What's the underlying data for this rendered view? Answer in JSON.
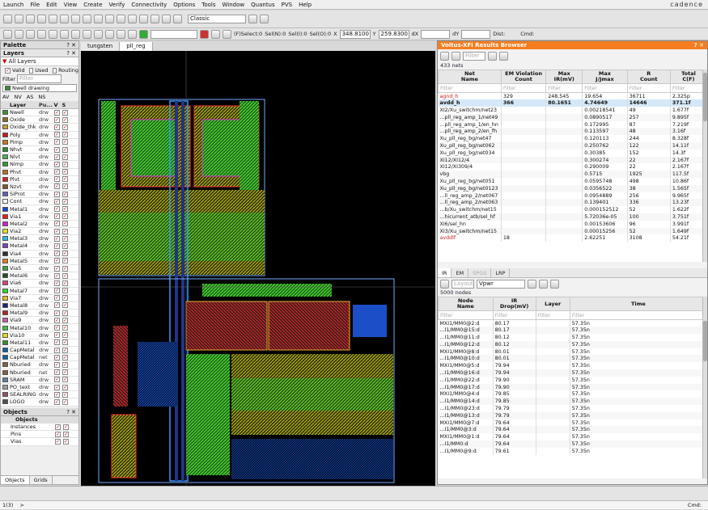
{
  "menu": [
    "Launch",
    "File",
    "Edit",
    "View",
    "Create",
    "Verify",
    "Connectivity",
    "Options",
    "Tools",
    "Window",
    "Quantus",
    "PVS",
    "Help"
  ],
  "brand": "cadence",
  "toolbar": {
    "workspace": "Classic",
    "select_status": "(F)Select:0",
    "seln": "Sel(N):0",
    "seli": "Sel(I):0",
    "selo": "Sel(O):0",
    "x_label": "X",
    "x_value": "348.8100",
    "y_label": "Y",
    "y_value": "259.8300",
    "dx_label": "dX",
    "dy_label": "dY",
    "dist_label": "Dist:",
    "cmd_label": "Cmd:"
  },
  "palette": {
    "title": "Palette",
    "layers_title": "Layers",
    "all_layers": "All Layers",
    "valid": "Valid",
    "used": "Used",
    "routing": "Routing",
    "filter_label": "Filter",
    "filter_placeholder": "Filter",
    "current_layer": "Nwell drawing",
    "vis_buttons": [
      "AV",
      "NV",
      "AS",
      "NS"
    ],
    "col_layer": "Layer",
    "col_purpose": "Pu...",
    "col_v": "V",
    "col_s": "S",
    "layers": [
      {
        "name": "Nwell",
        "purpose": "drw",
        "color": "#3c8f3c"
      },
      {
        "name": "Oxide",
        "purpose": "drw",
        "color": "#8a6d2a"
      },
      {
        "name": "Oxide_thk",
        "purpose": "drw",
        "color": "#c8a030"
      },
      {
        "name": "Poly",
        "purpose": "drw",
        "color": "#d01818"
      },
      {
        "name": "Pimp",
        "purpose": "drw",
        "color": "#c87818"
      },
      {
        "name": "Nhvt",
        "purpose": "drw",
        "color": "#2a8a2a"
      },
      {
        "name": "Nlvt",
        "purpose": "drw",
        "color": "#50b050"
      },
      {
        "name": "Nimp",
        "purpose": "drw",
        "color": "#30a030"
      },
      {
        "name": "Phvt",
        "purpose": "drw",
        "color": "#b87020"
      },
      {
        "name": "Plvt",
        "purpose": "drw",
        "color": "#d02020"
      },
      {
        "name": "Nzvt",
        "purpose": "drw",
        "color": "#7a5a20"
      },
      {
        "name": "SiProt",
        "purpose": "drw",
        "color": "#6060c0"
      },
      {
        "name": "Cont",
        "purpose": "drw",
        "color": "#ffffff"
      },
      {
        "name": "Metal1",
        "purpose": "drw",
        "color": "#2040e0"
      },
      {
        "name": "Via1",
        "purpose": "drw",
        "color": "#e02020"
      },
      {
        "name": "Metal2",
        "purpose": "drw",
        "color": "#d020d0"
      },
      {
        "name": "Via2",
        "purpose": "drw",
        "color": "#e0e020"
      },
      {
        "name": "Metal3",
        "purpose": "drw",
        "color": "#20c0e0"
      },
      {
        "name": "Metal4",
        "purpose": "drw",
        "color": "#8040c0"
      },
      {
        "name": "Via4",
        "purpose": "drw",
        "color": "#303030"
      },
      {
        "name": "Metal5",
        "purpose": "drw",
        "color": "#e08020"
      },
      {
        "name": "Via5",
        "purpose": "drw",
        "color": "#40a040"
      },
      {
        "name": "Metal6",
        "purpose": "drw",
        "color": "#205020"
      },
      {
        "name": "Via6",
        "purpose": "drw",
        "color": "#e04080"
      },
      {
        "name": "Metal7",
        "purpose": "drw",
        "color": "#20e020"
      },
      {
        "name": "Via7",
        "purpose": "drw",
        "color": "#e0c020"
      },
      {
        "name": "Metal8",
        "purpose": "drw",
        "color": "#202080"
      },
      {
        "name": "Metal9",
        "purpose": "drw",
        "color": "#c02020"
      },
      {
        "name": "Via9",
        "purpose": "drw",
        "color": "#c060a0"
      },
      {
        "name": "Metal10",
        "purpose": "drw",
        "color": "#40c040"
      },
      {
        "name": "Via10",
        "purpose": "drw",
        "color": "#e0e020"
      },
      {
        "name": "Metal11",
        "purpose": "drw",
        "color": "#309030"
      },
      {
        "name": "CapMetal",
        "purpose": "drw",
        "color": "#1060a0"
      },
      {
        "name": "CapMetal",
        "purpose": "net",
        "color": "#1060a0"
      },
      {
        "name": "Nburied",
        "purpose": "drw",
        "color": "#806040"
      },
      {
        "name": "Nburied",
        "purpose": "net",
        "color": "#806040"
      },
      {
        "name": "SRAM",
        "purpose": "drw",
        "color": "#6080a0"
      },
      {
        "name": "PO_text",
        "purpose": "drw",
        "color": "#a0a0a0"
      },
      {
        "name": "SEALRING",
        "purpose": "drw",
        "color": "#905070"
      },
      {
        "name": "LOGO",
        "purpose": "drw",
        "color": "#505050"
      }
    ],
    "objects_title": "Objects",
    "objects_header": "Objects",
    "objects": [
      "Instances",
      "Pins",
      "Vias"
    ],
    "bottom_tabs": [
      "Objects",
      "Grids"
    ]
  },
  "tabs": [
    "tungsten",
    "pll_reg"
  ],
  "results": {
    "title": "Voltus-XFi Results Browser",
    "filter_placeholder": "Filter",
    "nets_count": "433 nets",
    "columns": [
      "Net\nName",
      "EM Violation\nCount",
      "Max\nIR(mV)",
      "Max\nJ/Jmax",
      "R\nCount",
      "Total\nC(F)"
    ],
    "filter_row": [
      "Filter",
      "Filter",
      "Filter",
      "Filter",
      "Filter",
      "Filter"
    ],
    "rows": [
      [
        "agnd_h",
        "329",
        "248.545",
        "19.654",
        "36711",
        "2.325p"
      ],
      [
        "avdd_h",
        "366",
        "80.1651",
        "4.74649",
        "14646",
        "371.1f"
      ],
      [
        "XI2/Xu_switchm/net23",
        "",
        "",
        "0.00218541",
        "49",
        "1.677f"
      ],
      [
        "...pll_reg_amp_1/net49",
        "",
        "",
        "0.0890517",
        "257",
        "9.895f"
      ],
      [
        "...pll_reg_amp_1/en_hn",
        "",
        "",
        "0.172995",
        "87",
        "7.219f"
      ],
      [
        "...pll_reg_amp_2/en_fh",
        "",
        "",
        "0.113597",
        "48",
        "3.16f"
      ],
      [
        "Xu_pll_reg_bg/net47",
        "",
        "",
        "0.120113",
        "244",
        "8.328f"
      ],
      [
        "Xu_pll_reg_bg/net062",
        "",
        "",
        "0.250762",
        "122",
        "14.11f"
      ],
      [
        "Xu_pll_reg_bg/net034",
        "",
        "",
        "0.30385",
        "152",
        "14.3f"
      ],
      [
        "XI12/XI12/4",
        "",
        "",
        "0.300274",
        "22",
        "2.167f"
      ],
      [
        "XI12/XI309/4",
        "",
        "",
        "0.290009",
        "22",
        "2.167f"
      ],
      [
        "vbg",
        "",
        "",
        "0.5715",
        "1925",
        "117.5f"
      ],
      [
        "Xu_pll_reg_bg/net051",
        "",
        "",
        "0.0595748",
        "498",
        "10.86f"
      ],
      [
        "Xu_pll_reg_bg/net0123",
        "",
        "",
        "0.0356522",
        "38",
        "1.565f"
      ],
      [
        "...ll_reg_amp_2/net067",
        "",
        "",
        "0.0954889",
        "256",
        "9.965f"
      ],
      [
        "...ll_reg_amp_2/net063",
        "",
        "",
        "0.139401",
        "336",
        "13.23f"
      ],
      [
        "...b/Xu_switchm/net15",
        "",
        "",
        "0.000152512",
        "52",
        "1.622f"
      ],
      [
        "...hicurrent_atb/sel_hf",
        "",
        "",
        "5.72036e-05",
        "100",
        "3.751f"
      ],
      [
        "XI6/sel_hn",
        "",
        "",
        "0.00153606",
        "96",
        "3.991f"
      ],
      [
        "XI3/Xu_switchm/net15",
        "",
        "",
        "0.00015256",
        "52",
        "1.649f"
      ],
      [
        "avddlf",
        "18",
        "",
        "2.62251",
        "3108",
        "54.21f"
      ]
    ],
    "sub_tabs": [
      "IR",
      "EM",
      "SPGS",
      "LRP"
    ],
    "layout_label": "Layout",
    "net_select": "Vpwr",
    "nodes_count": "5000 nodes",
    "node_columns": [
      "Node\nName",
      "IR\nDrop(mV)",
      "Layer",
      "Time"
    ],
    "node_filter_row": [
      "Filter",
      "Filter",
      "Filter",
      "Filter"
    ],
    "nodes": [
      [
        "MXI1/MM0@2:d",
        "80.17",
        "",
        "57.35n"
      ],
      [
        "...I1/MM0@15:d",
        "80.17",
        "",
        "57.35n"
      ],
      [
        "...I1/MM0@11:d",
        "80.12",
        "",
        "57.35n"
      ],
      [
        "...I1/MM0@12:d",
        "80.12",
        "",
        "57.35n"
      ],
      [
        "MXI1/MM0@8:d",
        "80.01",
        "",
        "57.35n"
      ],
      [
        "...I1/MM0@10:d",
        "80.01",
        "",
        "57.35n"
      ],
      [
        "MXI1/MM0@5:d",
        "79.94",
        "",
        "57.35n"
      ],
      [
        "...I1/MM0@16:d",
        "79.94",
        "",
        "57.35n"
      ],
      [
        "...I1/MM0@22:d",
        "79.90",
        "",
        "57.35n"
      ],
      [
        "...I1/MM0@17:d",
        "79.90",
        "",
        "57.35n"
      ],
      [
        "MXI1/MM0@4:d",
        "79.85",
        "",
        "57.35n"
      ],
      [
        "...I1/MM0@14:d",
        "79.85",
        "",
        "57.35n"
      ],
      [
        "...I1/MM0@23:d",
        "79.79",
        "",
        "57.35n"
      ],
      [
        "...I1/MM0@13:d",
        "79.79",
        "",
        "57.35n"
      ],
      [
        "MXI1/MM0@7:d",
        "79.64",
        "",
        "57.35n"
      ],
      [
        "...I1/MM0@3:d",
        "79.64",
        "",
        "57.35n"
      ],
      [
        "MXI1/MM0@1:d",
        "79.64",
        "",
        "57.35n"
      ],
      [
        "...I1/MM0:d",
        "79.64",
        "",
        "57.35n"
      ],
      [
        "...I1/MM0@9:d",
        "79.61",
        "",
        "57.35n"
      ]
    ]
  },
  "status": {
    "prompt": "1(3)",
    "arrow": ">",
    "cmd": "Cmd:"
  }
}
